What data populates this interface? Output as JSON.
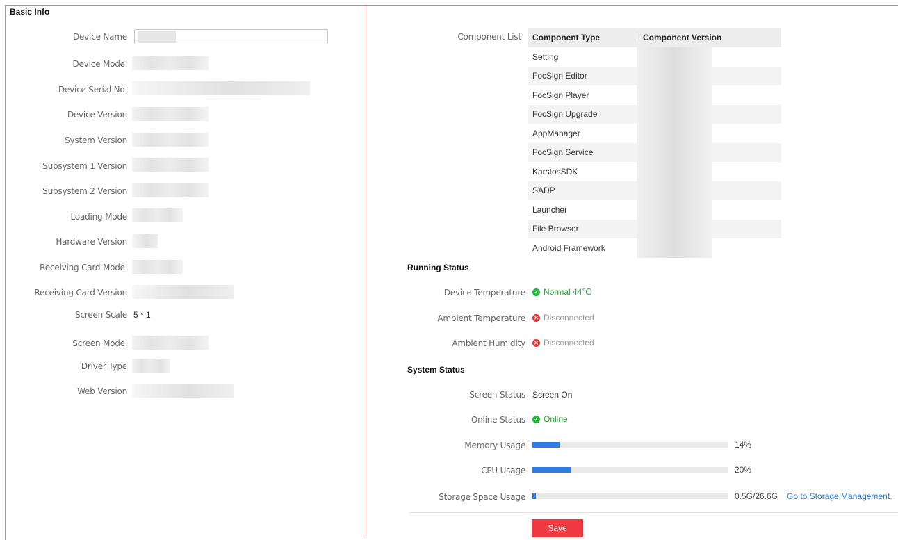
{
  "basic_info": {
    "title": "Basic Info",
    "rows": [
      {
        "label": "Device Name"
      },
      {
        "label": "Device Model"
      },
      {
        "label": "Device Serial No."
      },
      {
        "label": "Device Version"
      },
      {
        "label": "System Version"
      },
      {
        "label": "Subsystem 1 Version"
      },
      {
        "label": "Subsystem 2 Version"
      },
      {
        "label": "Loading Mode"
      },
      {
        "label": "Hardware Version"
      },
      {
        "label": "Receiving Card Model"
      },
      {
        "label": "Receiving Card Version"
      },
      {
        "label": "Screen Scale",
        "value": "5 * 1"
      },
      {
        "label": "Screen Model"
      },
      {
        "label": "Driver Type"
      },
      {
        "label": "Web Version"
      }
    ]
  },
  "component_list": {
    "label": "Component List",
    "headers": [
      "Component Type",
      "Component Version"
    ],
    "items": [
      "Setting",
      "FocSign Editor",
      "FocSign Player",
      "FocSign Upgrade",
      "AppManager",
      "FocSign Service",
      "KarstosSDK",
      "SADP",
      "Launcher",
      "File Browser",
      "Android Framework"
    ]
  },
  "running_status": {
    "title": "Running Status",
    "rows": [
      {
        "label": "Device Temperature",
        "value": "Normal 44℃",
        "state": "ok"
      },
      {
        "label": "Ambient Temperature",
        "value": "Disconnected",
        "state": "err"
      },
      {
        "label": "Ambient Humidity",
        "value": "Disconnected",
        "state": "err"
      }
    ]
  },
  "system_status": {
    "title": "System Status",
    "screen_status": {
      "label": "Screen Status",
      "value": "Screen On"
    },
    "online_status": {
      "label": "Online Status",
      "value": "Online",
      "state": "ok"
    },
    "memory": {
      "label": "Memory Usage",
      "value": "14%",
      "fraction": 0.14
    },
    "cpu": {
      "label": "CPU Usage",
      "value": "20%",
      "fraction": 0.2
    },
    "storage": {
      "label": "Storage Space Usage",
      "value": "0.5G/26.6G",
      "fraction": 0.019,
      "link": "Go to Storage Management."
    }
  },
  "actions": {
    "save_label": "Save"
  },
  "colors": {
    "accent_red": "#f03840",
    "ok_green": "#1fb833",
    "err_red": "#e63232",
    "bar_blue": "#2f7ce3",
    "link_blue": "#2e74d6"
  }
}
